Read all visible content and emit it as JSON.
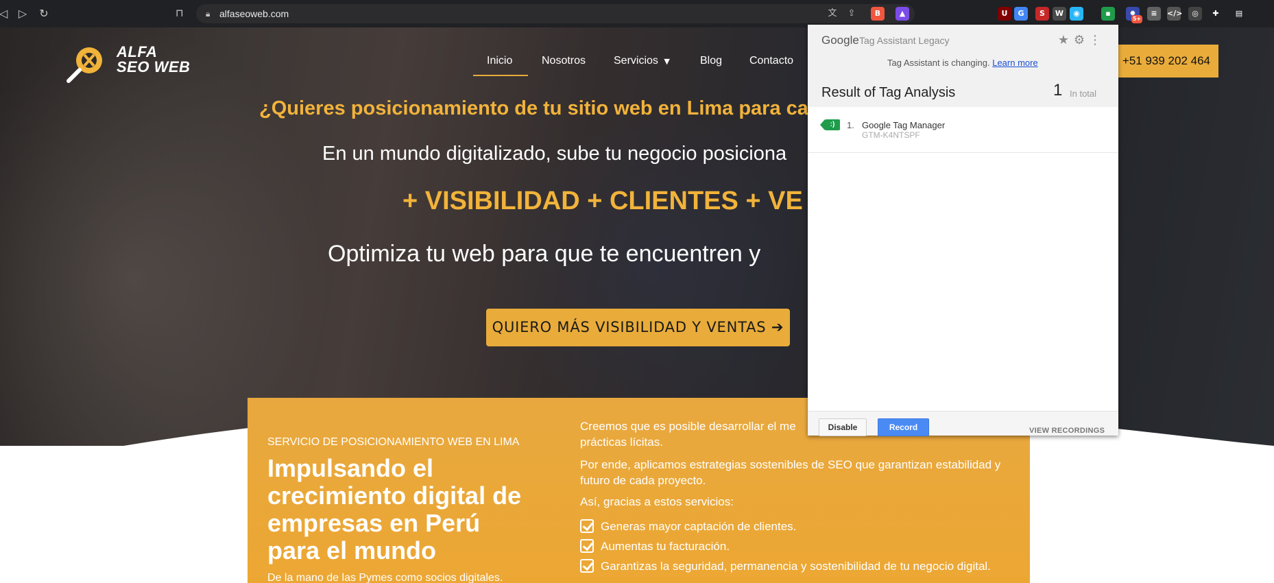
{
  "browser": {
    "url": "alfaseoweb.com",
    "extensions": [
      {
        "name": "brave-shield-icon",
        "color": "#f1563f",
        "glyph": "B"
      },
      {
        "name": "brave-rewards-icon",
        "color": "#7a4ce8",
        "glyph": "▲"
      },
      {
        "name": "ublock-icon",
        "color": "#800000",
        "glyph": "U"
      },
      {
        "name": "google-translate-icon",
        "color": "#4285f4",
        "glyph": "G"
      },
      {
        "name": "seo-extension-icon",
        "color": "#c62828",
        "glyph": "S"
      },
      {
        "name": "wappalyzer-icon",
        "color": "#4a4a4a",
        "glyph": "W"
      },
      {
        "name": "color-picker-icon",
        "color": "#29b6f6",
        "glyph": "◉"
      },
      {
        "name": "tag-assistant-icon",
        "color": "#1e9c4a",
        "glyph": "▪"
      },
      {
        "name": "seoquake-icon",
        "color": "#3949ab",
        "glyph": "✹"
      },
      {
        "name": "database-icon",
        "color": "#616161",
        "glyph": "≡"
      },
      {
        "name": "code-viewer-icon",
        "color": "#555555",
        "glyph": "</>"
      },
      {
        "name": "theme-icon",
        "color": "#424242",
        "glyph": "◎"
      },
      {
        "name": "puzzle-icon",
        "color": "#202124",
        "glyph": "✚"
      },
      {
        "name": "sidebar-icon",
        "color": "#202124",
        "glyph": "▤"
      }
    ],
    "badge": "5+"
  },
  "site": {
    "logo_line1": "ALFA",
    "logo_line2": "SEO WEB",
    "menu": [
      "Inicio",
      "Nosotros",
      "Servicios",
      "Blog",
      "Contacto"
    ],
    "phone": "+51 939 202 464",
    "question": "¿Quieres posicionamiento de tu sitio web en Lima para ca",
    "digital": "En un mundo digitalizado, sube tu negocio posiciona",
    "visibility": "+ VISIBILIDAD + CLIENTES + VE",
    "optimize": "Optimiza tu web para que te encuentren y",
    "cta": "QUIERO MÁS VISIBILIDAD Y VENTAS",
    "service": {
      "kicker": "SERVICIO DE POSICIONAMIENTO WEB EN LIMA",
      "headline": "Impulsando el crecimiento digital de empresas en Perú para el mundo",
      "sub": "De la mano de las Pymes como socios digitales.",
      "p1": "Creemos que es posible desarrollar el me",
      "p1b": "prácticas lícitas.",
      "p2": "Por ende, aplicamos estrategias sostenibles de SEO que garantizan estabilidad y futuro de cada proyecto.",
      "p3": "Así, gracias a estos servicios:",
      "bullets": [
        "Generas mayor captación de clientes.",
        "Aumentas tu facturación.",
        "Garantizas la seguridad, permanencia y sostenibilidad de tu negocio digital."
      ]
    }
  },
  "tag_assistant": {
    "brand": "Google",
    "brand_sub": "Tag Assistant Legacy",
    "notice": "Tag Assistant is changing.",
    "notice_link": "Learn more",
    "result_title": "Result of Tag Analysis",
    "count": "1",
    "count_label": "In total",
    "tags": [
      {
        "number": "1.",
        "name": "Google Tag Manager",
        "id": "GTM-K4NTSPF"
      }
    ],
    "disable_label": "Disable",
    "record_label": "Record",
    "view_recordings_label": "VIEW RECORDINGS"
  }
}
